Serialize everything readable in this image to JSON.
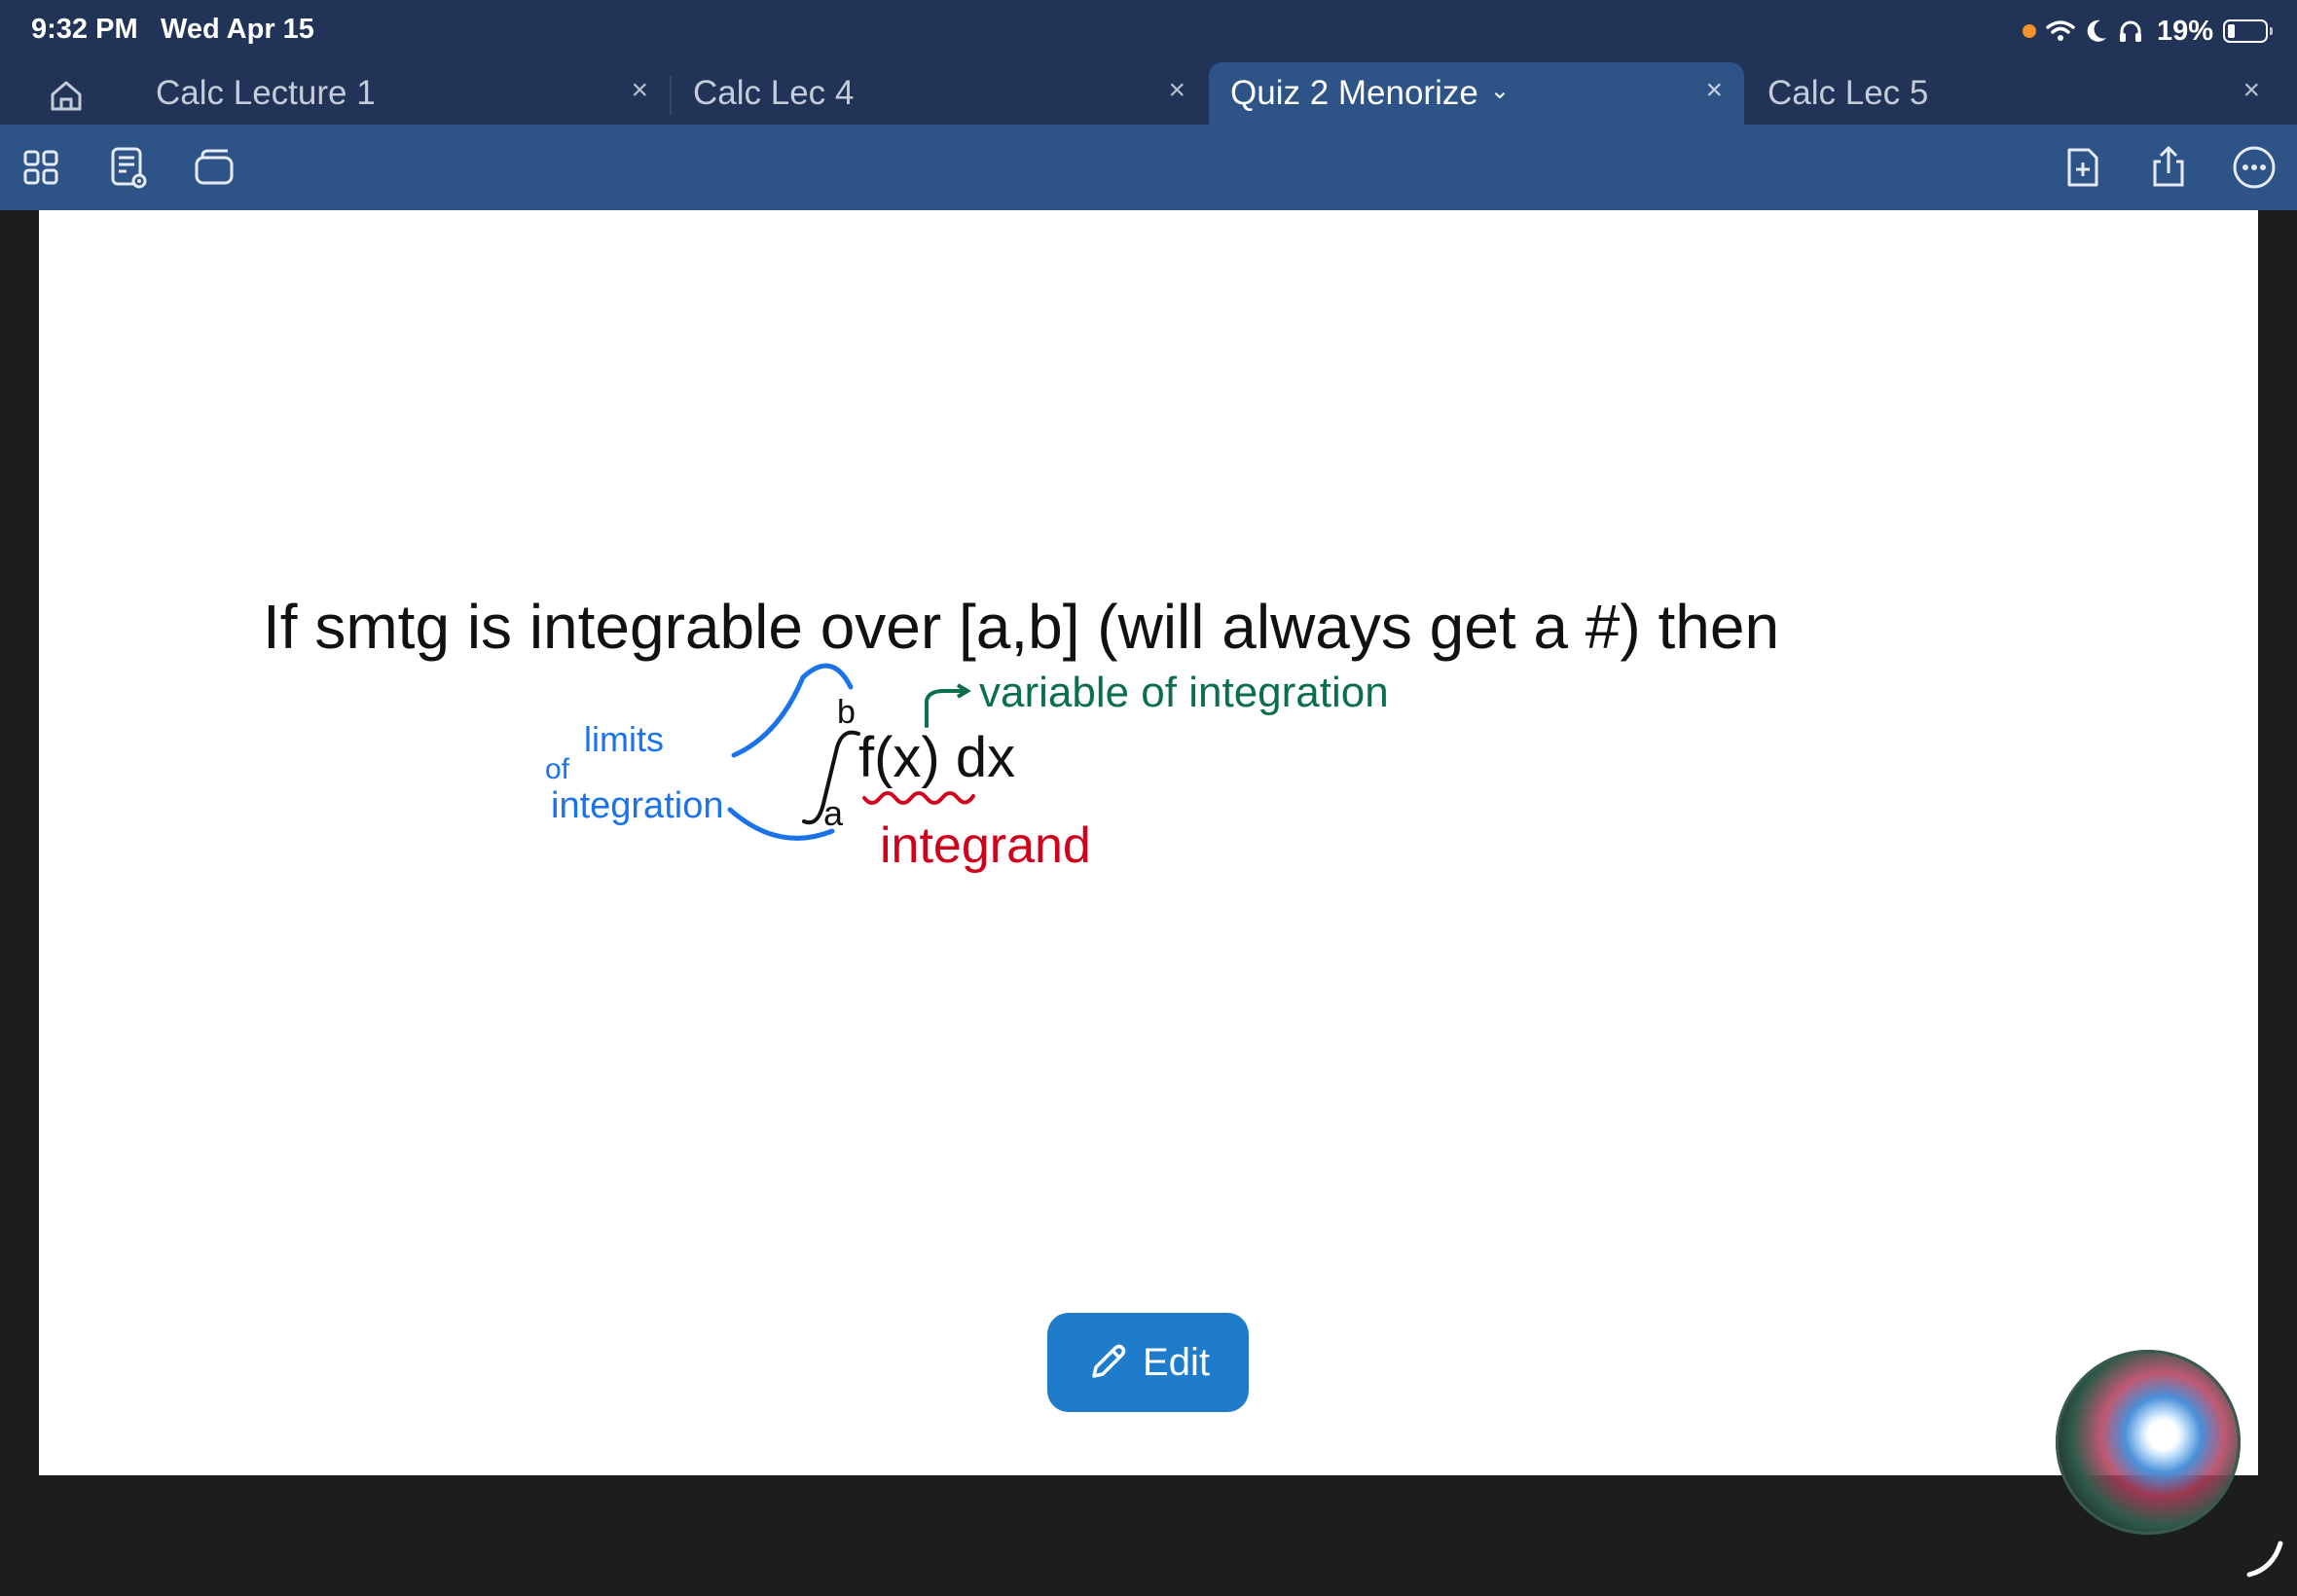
{
  "status": {
    "time": "9:32 PM",
    "date": "Wed Apr 15",
    "battery": "19%"
  },
  "tabs": [
    {
      "label": "Calc Lecture 1",
      "close": "×",
      "active": false
    },
    {
      "label": "Calc Lec 4",
      "close": "×",
      "active": false
    },
    {
      "label": "Quiz 2 Menorize",
      "close": "×",
      "active": true
    },
    {
      "label": "Calc Lec 5",
      "close": "×",
      "active": false
    }
  ],
  "toolbar": {
    "left_icons": [
      "grid-view-icon",
      "document-preview-icon",
      "window-icon"
    ],
    "right_icons": [
      "add-page-icon",
      "share-icon",
      "more-icon"
    ]
  },
  "note": {
    "line1": "If smtg is integrable over [a,b] (will always get a #) then",
    "integral": "f(x) dx",
    "upper_limit": "b",
    "lower_limit": "a",
    "annotation_limits_1": "limits",
    "annotation_limits_2": "of",
    "annotation_limits_3": "integration",
    "annotation_variable": "variable of integration",
    "annotation_integrand": "integrand"
  },
  "edit_button": {
    "label": "Edit"
  },
  "colors": {
    "statusbar": "#213457",
    "toolbar": "#2d5387",
    "blue_ink": "#1a73e8",
    "green_ink": "#0b6e4f",
    "red_ink": "#d0021b",
    "edit_button": "#1f7ccb"
  }
}
